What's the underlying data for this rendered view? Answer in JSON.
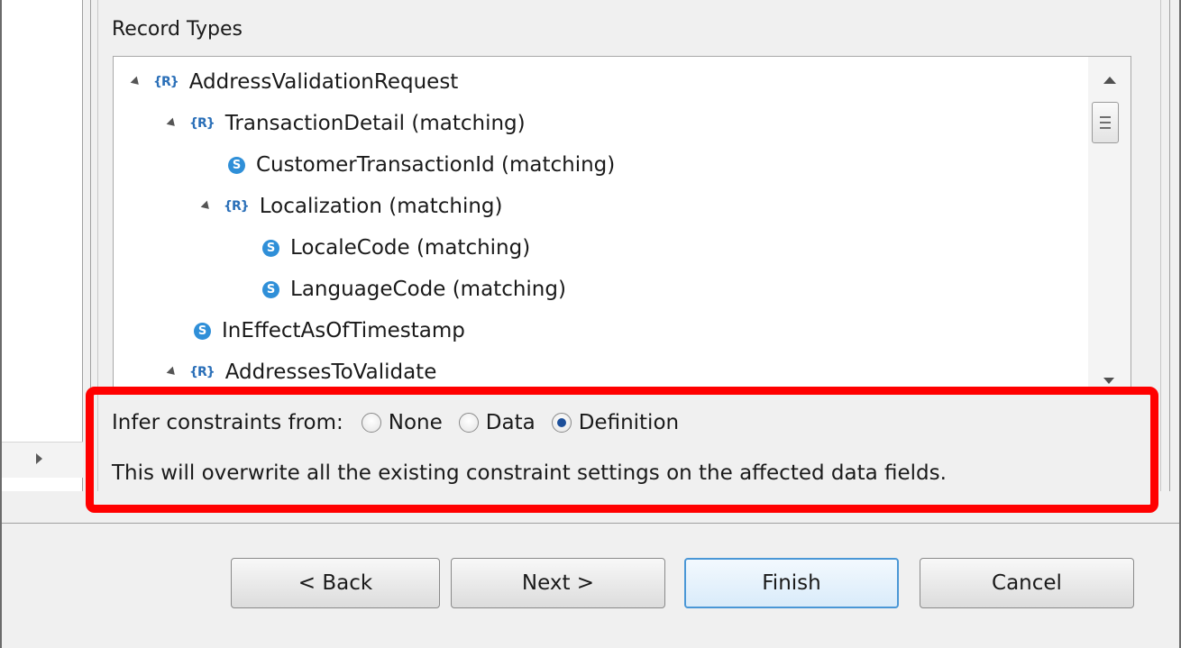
{
  "group": {
    "label": "Record Types"
  },
  "tree": {
    "items": [
      {
        "label": "AddressValidationRequest",
        "kind": "record",
        "expanded": true
      },
      {
        "label": "TransactionDetail (matching)",
        "kind": "record",
        "expanded": true
      },
      {
        "label": "CustomerTransactionId (matching)",
        "kind": "string"
      },
      {
        "label": "Localization (matching)",
        "kind": "record",
        "expanded": true
      },
      {
        "label": "LocaleCode (matching)",
        "kind": "string"
      },
      {
        "label": "LanguageCode (matching)",
        "kind": "string"
      },
      {
        "label": "InEffectAsOfTimestamp",
        "kind": "string"
      },
      {
        "label": "AddressesToValidate",
        "kind": "record",
        "expanded": true
      }
    ],
    "record_icon_glyph": "{R}",
    "string_icon_glyph": "S"
  },
  "infer": {
    "label": "Infer constraints from:",
    "options": [
      "None",
      "Data",
      "Definition"
    ],
    "selected": "Definition",
    "warning": "This will overwrite all the existing constraint settings on the affected data fields."
  },
  "buttons": {
    "back": "< Back",
    "next": "Next >",
    "finish": "Finish",
    "cancel": "Cancel"
  },
  "colors": {
    "highlight": "#ff0000",
    "icon_blue": "#2f8fd8",
    "default_button_border": "#4a97d6"
  }
}
